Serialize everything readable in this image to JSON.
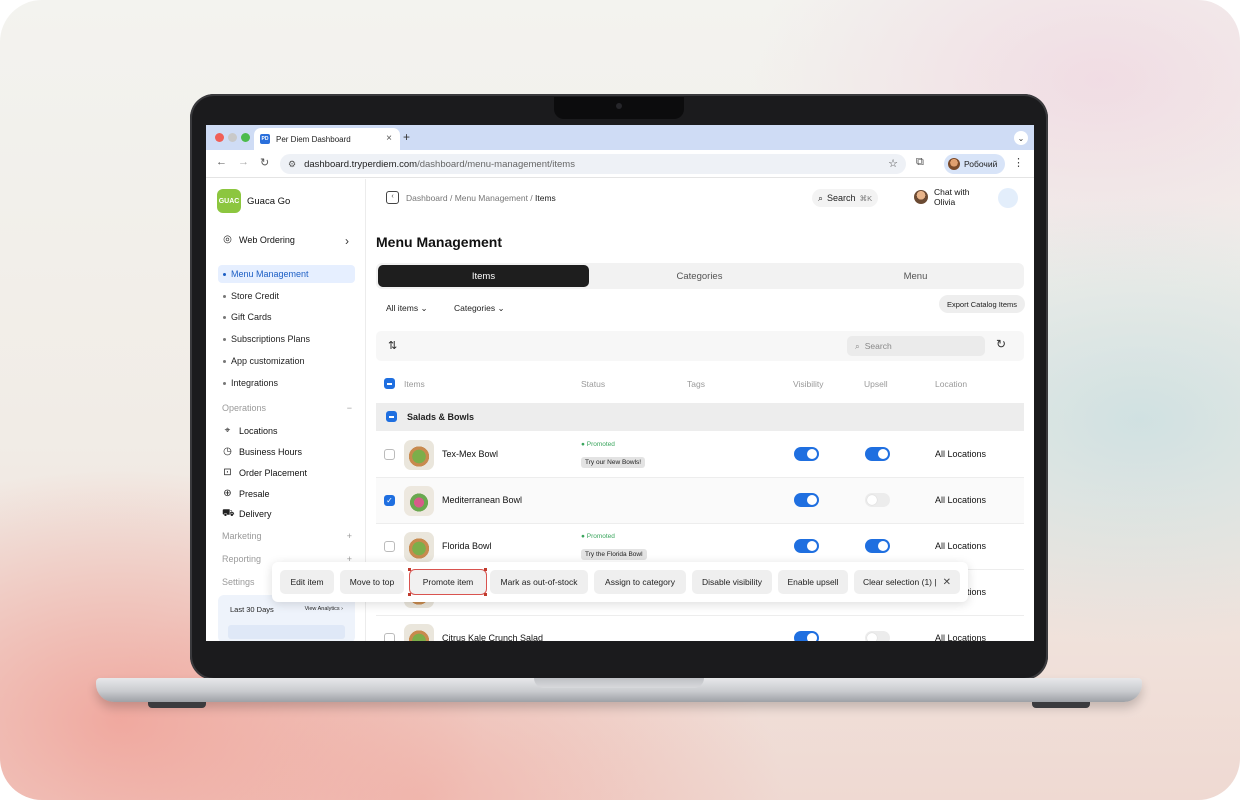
{
  "browser": {
    "tab_title": "Per Diem Dashboard",
    "favicon_text": "PD",
    "url_host": "dashboard.tryperdiem.com",
    "url_path": "/dashboard/menu-management/items",
    "profile_name": "Робочий"
  },
  "brand": {
    "name": "Guaca Go",
    "logo_text": "GUAC"
  },
  "sidebar": {
    "web_ordering": "Web Ordering",
    "items": [
      "Menu Management",
      "Store Credit",
      "Gift Cards",
      "Subscriptions Plans",
      "App customization",
      "Integrations"
    ],
    "operations_label": "Operations",
    "operations": [
      "Locations",
      "Business Hours",
      "Order Placement",
      "Presale",
      "Delivery"
    ],
    "marketing_label": "Marketing",
    "reporting_label": "Reporting",
    "settings_label": "Settings",
    "analytics": {
      "range": "Last 30 Days",
      "link": "View Analytics"
    }
  },
  "topbar": {
    "breadcrumb_1": "Dashboard",
    "breadcrumb_2": "Menu Management",
    "breadcrumb_3": "Items",
    "search_label": "Search",
    "search_kbd": "⌘K",
    "chat_line1": "Chat with",
    "chat_line2": "Olivia"
  },
  "page": {
    "title": "Menu Management",
    "tabs": [
      "Items",
      "Categories",
      "Menu"
    ],
    "filter_all": "All items",
    "filter_categories": "Categories",
    "export_label": "Export Catalog Items",
    "search_placeholder": "Search"
  },
  "table": {
    "columns": [
      "Items",
      "Status",
      "Tags",
      "Visibility",
      "Upsell",
      "Location"
    ],
    "group": "Salads & Bowls",
    "rows": [
      {
        "name": "Tex-Mex Bowl",
        "status": "Promoted",
        "tag": "Try our New Bowls!",
        "visibility": true,
        "upsell": true,
        "location": "All Locations",
        "checked": false
      },
      {
        "name": "Mediterranean Bowl",
        "status": "",
        "tag": "",
        "visibility": true,
        "upsell": false,
        "location": "All Locations",
        "checked": true
      },
      {
        "name": "Florida Bowl",
        "status": "Promoted",
        "tag": "Try the Florida Bowl",
        "visibility": true,
        "upsell": true,
        "location": "All Locations",
        "checked": false
      },
      {
        "name": "",
        "status": "",
        "tag": "",
        "visibility": true,
        "upsell": false,
        "location": "All Locations",
        "checked": false
      },
      {
        "name": "Citrus Kale Crunch Salad",
        "status": "",
        "tag": "",
        "visibility": true,
        "upsell": false,
        "location": "All Locations",
        "checked": false
      }
    ]
  },
  "actions": {
    "edit": "Edit item",
    "move_top": "Move to top",
    "promote": "Promote item",
    "out_of_stock": "Mark as out-of-stock",
    "assign": "Assign to category",
    "disable_visibility": "Disable visibility",
    "enable_upsell": "Enable upsell",
    "clear": "Clear selection (1) |"
  },
  "colors": {
    "accent": "#1f6fe0",
    "active_bg": "#e6efff",
    "promoted": "#3aa55d",
    "dark_tab": "#1e1e1e"
  }
}
